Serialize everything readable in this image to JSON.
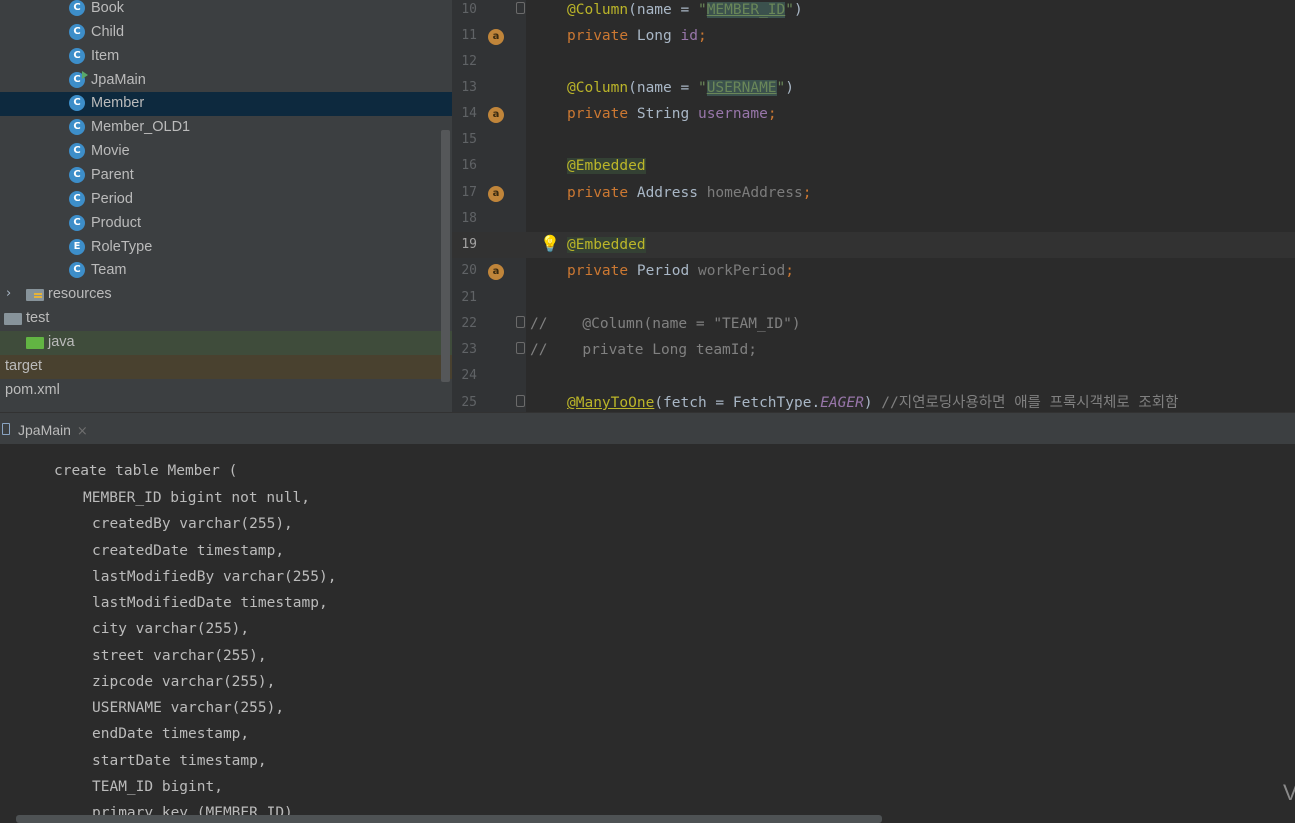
{
  "project_tree": {
    "items": [
      {
        "label": "Book",
        "icon": "class-icon",
        "name": "tree-item-book"
      },
      {
        "label": "Child",
        "icon": "class-icon",
        "name": "tree-item-child"
      },
      {
        "label": "Item",
        "icon": "class-icon",
        "name": "tree-item-item"
      },
      {
        "label": "JpaMain",
        "icon": "runnable-class-icon",
        "name": "tree-item-jpamain"
      },
      {
        "label": "Member",
        "icon": "class-icon",
        "name": "tree-item-member",
        "selected": true
      },
      {
        "label": "Member_OLD1",
        "icon": "class-icon",
        "name": "tree-item-member-old1"
      },
      {
        "label": "Movie",
        "icon": "class-icon",
        "name": "tree-item-movie"
      },
      {
        "label": "Parent",
        "icon": "class-icon",
        "name": "tree-item-parent"
      },
      {
        "label": "Period",
        "icon": "class-icon",
        "name": "tree-item-period"
      },
      {
        "label": "Product",
        "icon": "class-icon",
        "name": "tree-item-product"
      },
      {
        "label": "RoleType",
        "icon": "enum-icon",
        "name": "tree-item-roletype"
      },
      {
        "label": "Team",
        "icon": "class-icon",
        "name": "tree-item-team"
      },
      {
        "label": "resources",
        "icon": "resources-folder-icon",
        "name": "tree-item-resources"
      },
      {
        "label": "test",
        "icon": "folder-icon",
        "name": "tree-item-test"
      },
      {
        "label": "java",
        "icon": "test-source-folder-icon",
        "name": "tree-item-java"
      },
      {
        "label": "target",
        "icon": "none",
        "name": "tree-item-target"
      },
      {
        "label": "pom.xml",
        "icon": "none",
        "name": "tree-item-pom"
      }
    ],
    "class_badge": "C",
    "enum_badge": "E",
    "expand_glyph": "›"
  },
  "editor": {
    "line_numbers": [
      "10",
      "11",
      "12",
      "13",
      "14",
      "15",
      "16",
      "17",
      "18",
      "19",
      "20",
      "21",
      "22",
      "23",
      "24",
      "25"
    ],
    "current_line": "19",
    "field_badge": "a",
    "bulb_glyph": "💡",
    "tokens": {
      "column": "@Column",
      "name_eq_open": "(name = ",
      "quote": "\"",
      "member_id": "MEMBER_ID",
      "close_paren": ")",
      "private": "private",
      "long_t": "Long",
      "id": "id",
      "semi": ";",
      "username_col": "USERNAME",
      "string_t": "String",
      "username": "username",
      "embedded": "@Embedded",
      "address_t": "Address",
      "home_address": "homeAddress",
      "period_t": "Period",
      "work_period": "workPeriod",
      "comment_line22": "//    @Column(name = \"TEAM_ID\")",
      "comment_line23": "//    private Long teamId;",
      "many_to_one": "@ManyToOne",
      "fetch_open": "(fetch = FetchType.",
      "eager": "EAGER",
      "fetch_close": ")",
      "comment_line25": " //지연로딩사용하면 애를 프록시객체로 조회함"
    }
  },
  "run_window": {
    "tab_label": "JpaMain",
    "close_glyph": "×",
    "console_lines": [
      "create table Member (",
      "MEMBER_ID bigint not null,",
      "createdBy varchar(255),",
      "createdDate timestamp,",
      "lastModifiedBy varchar(255),",
      "lastModifiedDate timestamp,",
      "city varchar(255),",
      "street varchar(255),",
      "zipcode varchar(255),",
      "USERNAME varchar(255),",
      "endDate timestamp,",
      "startDate timestamp,",
      "TEAM_ID bigint,",
      "primary key (MEMBER_ID)"
    ],
    "corner_glyph": "V"
  },
  "colors": {
    "selection": "#0d293e",
    "class_icon": "#3d8ec9",
    "annotation": "#bbb529",
    "keyword": "#cc7832",
    "string": "#6a8759",
    "field": "#9876aa"
  }
}
